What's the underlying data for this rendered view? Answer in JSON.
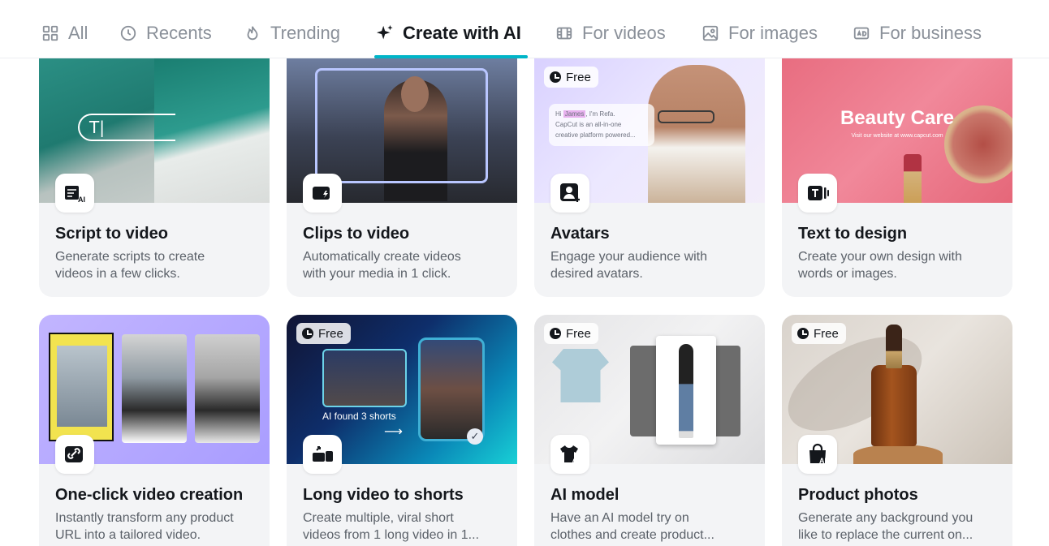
{
  "tabs": [
    {
      "label": "All",
      "icon": "grid-icon",
      "active": false
    },
    {
      "label": "Recents",
      "icon": "clock-icon",
      "active": false
    },
    {
      "label": "Trending",
      "icon": "flame-icon",
      "active": false
    },
    {
      "label": "Create with AI",
      "icon": "sparkle-icon",
      "active": true
    },
    {
      "label": "For videos",
      "icon": "film-icon",
      "active": false
    },
    {
      "label": "For images",
      "icon": "image-icon",
      "active": false
    },
    {
      "label": "For business",
      "icon": "ad-icon",
      "active": false
    }
  ],
  "accent_color": "#00b5c8",
  "cards": [
    {
      "title": "Script to video",
      "desc": [
        "Generate scripts to create",
        "videos in a few clicks."
      ],
      "icon": "script-ai-icon",
      "free": false,
      "thumb_text": "T|"
    },
    {
      "title": "Clips to video",
      "desc": [
        "Automatically create videos",
        "with your media in 1 click."
      ],
      "icon": "clips-icon",
      "free": false
    },
    {
      "title": "Avatars",
      "desc": [
        "Engage your audience with",
        "desired avatars."
      ],
      "icon": "avatar-icon",
      "free": true,
      "free_label": "Free",
      "bubble": {
        "line1_pre": "Hi ",
        "name": "James",
        "line1_post": ", I'm Refa.",
        "line2": "CapCut is an all-in-one",
        "line3": "creative platform powered..."
      }
    },
    {
      "title": "Text to design",
      "desc": [
        "Create your own design with",
        "words or images."
      ],
      "icon": "text-design-icon",
      "free": false,
      "thumb_title": "Beauty Care",
      "thumb_sub": "Visit our website at www.capcut.com"
    },
    {
      "title": "One-click video creation",
      "desc": [
        "Instantly transform any product",
        "URL into a tailored video."
      ],
      "icon": "link-video-icon",
      "free": false
    },
    {
      "title": "Long video to shorts",
      "desc": [
        "Create multiple, viral short",
        "videos from 1 long video in 1..."
      ],
      "icon": "shorts-icon",
      "free": true,
      "free_label": "Free",
      "thumb_text": "AI found 3 shorts"
    },
    {
      "title": "AI model",
      "desc": [
        "Have an AI model try on",
        "clothes and create product..."
      ],
      "icon": "shirt-ai-icon",
      "free": true,
      "free_label": "Free"
    },
    {
      "title": "Product photos",
      "desc": [
        "Generate any background you",
        "like to replace the current on..."
      ],
      "icon": "bag-ai-icon",
      "free": true,
      "free_label": "Free"
    }
  ]
}
